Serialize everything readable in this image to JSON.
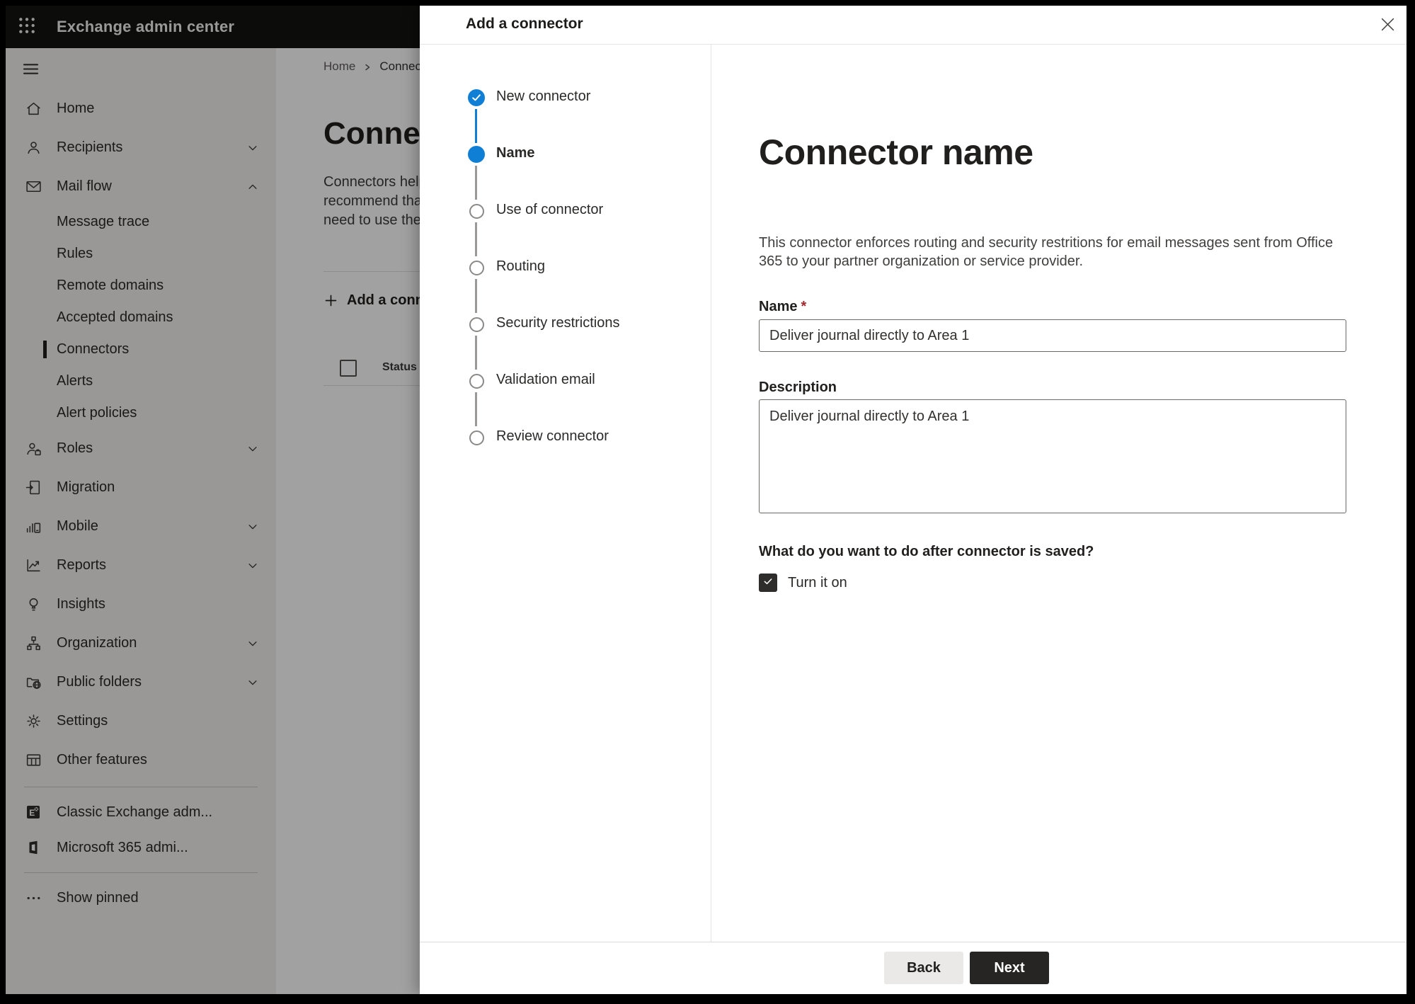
{
  "topbar": {
    "title": "Exchange admin center"
  },
  "sidebar": {
    "items": [
      {
        "label": "Home",
        "icon": "home-icon"
      },
      {
        "label": "Recipients",
        "icon": "person-icon",
        "chevron": "down"
      },
      {
        "label": "Mail flow",
        "icon": "mail-icon",
        "chevron": "up",
        "expanded": true
      },
      {
        "label": "Message trace",
        "sub": true
      },
      {
        "label": "Rules",
        "sub": true
      },
      {
        "label": "Remote domains",
        "sub": true
      },
      {
        "label": "Accepted domains",
        "sub": true
      },
      {
        "label": "Connectors",
        "sub": true,
        "selected": true
      },
      {
        "label": "Alerts",
        "sub": true
      },
      {
        "label": "Alert policies",
        "sub": true
      },
      {
        "label": "Roles",
        "icon": "roles-icon",
        "chevron": "down"
      },
      {
        "label": "Migration",
        "icon": "migration-icon"
      },
      {
        "label": "Mobile",
        "icon": "mobile-icon",
        "chevron": "down"
      },
      {
        "label": "Reports",
        "icon": "reports-icon",
        "chevron": "down"
      },
      {
        "label": "Insights",
        "icon": "lightbulb-icon"
      },
      {
        "label": "Organization",
        "icon": "org-tree-icon",
        "chevron": "down"
      },
      {
        "label": "Public folders",
        "icon": "folder-globe-icon",
        "chevron": "down"
      },
      {
        "label": "Settings",
        "icon": "gear-icon"
      },
      {
        "label": "Other features",
        "icon": "table-icon"
      }
    ],
    "classic_exchange": "Classic Exchange adm...",
    "m365_admin": "Microsoft 365 admi...",
    "show_pinned": "Show pinned"
  },
  "page": {
    "breadcrumb": {
      "home": "Home",
      "current": "Connectors"
    },
    "heading": "Connectors",
    "intro_lines": [
      "Connectors help",
      "recommend that",
      "need to use ther"
    ],
    "add_button": "Add a connector",
    "table": {
      "status_header": "Status"
    }
  },
  "dialog": {
    "title": "Add a connector",
    "steps": [
      {
        "label": "New connector",
        "state": "completed"
      },
      {
        "label": "Name",
        "state": "current"
      },
      {
        "label": "Use of connector",
        "state": "todo"
      },
      {
        "label": "Routing",
        "state": "todo"
      },
      {
        "label": "Security restrictions",
        "state": "todo"
      },
      {
        "label": "Validation email",
        "state": "todo"
      },
      {
        "label": "Review connector",
        "state": "todo"
      }
    ],
    "content": {
      "heading": "Connector name",
      "description": "This connector enforces routing and security restritions for email messages sent from Office 365 to your partner organization or service provider.",
      "name_label": "Name",
      "required_marker": "*",
      "name_value": "Deliver journal directly to Area 1",
      "description_label": "Description",
      "description_value": "Deliver journal directly to Area 1",
      "after_save_question": "What do you want to do after connector is saved?",
      "turn_on_label": "Turn it on",
      "turn_on_checked": true
    },
    "footer": {
      "back": "Back",
      "next": "Next"
    }
  },
  "colors": {
    "accent_blue": "#0f7fd6",
    "topbar_bg": "#131312",
    "overlay": "rgba(0,0,0,0.37)",
    "next_button_bg": "#262524",
    "checkbox_checked_bg": "#2e2d2c",
    "required_red": "#a4262c"
  }
}
